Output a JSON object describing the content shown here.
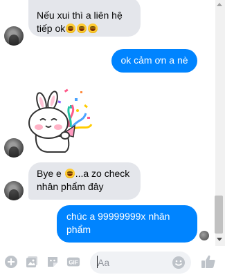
{
  "messages": [
    {
      "direction": "incoming",
      "text": "Nếu xui thì a liên hệ",
      "text2": "tiếp ok",
      "emoji_after": [
        "grinning-face",
        "grinning-face",
        "grinning-face"
      ]
    },
    {
      "direction": "outgoing",
      "text": "ok cảm ơn a nè"
    },
    {
      "direction": "incoming",
      "type": "sticker",
      "sticker": "bunny-party-popper-sticker"
    },
    {
      "direction": "incoming",
      "text_before_emoji": "Bye e ",
      "emoji": "grinning-face",
      "text_after_emoji": "...a zo check",
      "text2": "nhân phẩm đây"
    },
    {
      "direction": "outgoing",
      "text": "chúc a 99999999x nhân",
      "text2": "phẩm"
    }
  ],
  "composer": {
    "placeholder": "Aa",
    "tools": [
      "plus-icon",
      "photo-icon",
      "sticker-icon",
      "gif-icon"
    ],
    "emoji_icon": "smiley-icon",
    "send_icon": "thumbs-up-icon"
  },
  "colors": {
    "outgoing_bubble": "#0084ff",
    "incoming_bubble": "#e4e6eb",
    "accent": "#0084ff"
  }
}
